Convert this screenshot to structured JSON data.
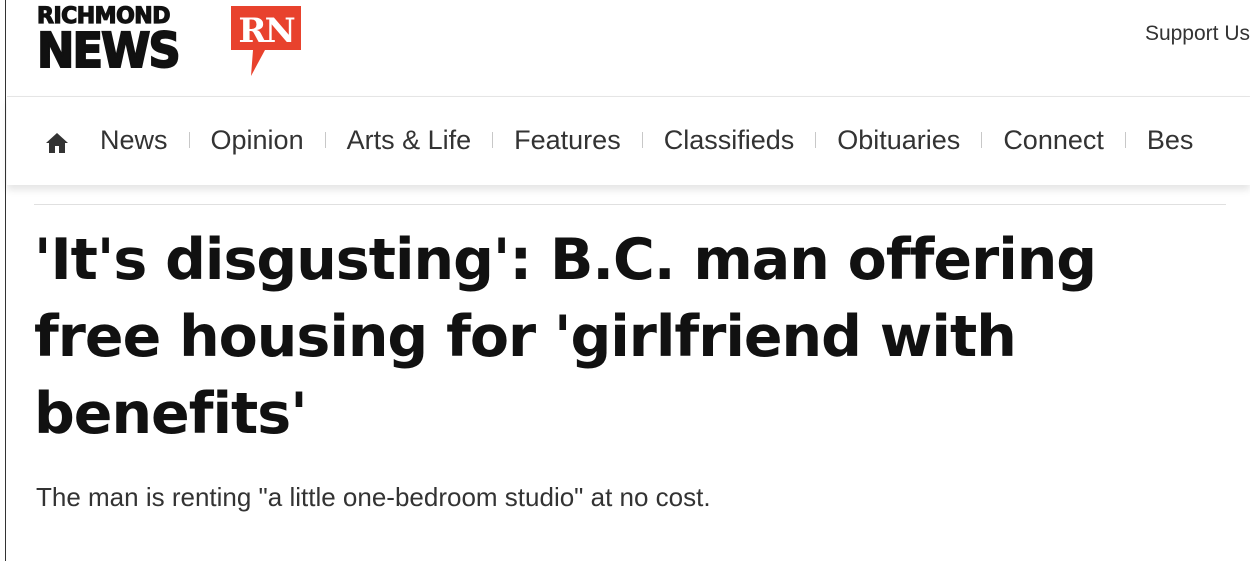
{
  "header": {
    "logo": {
      "line1": "RICHMOND",
      "line2": "NEWS",
      "badge": "RN"
    },
    "support_label": "Support Us"
  },
  "nav": {
    "items": [
      {
        "label": "News"
      },
      {
        "label": "Opinion"
      },
      {
        "label": "Arts & Life"
      },
      {
        "label": "Features"
      },
      {
        "label": "Classifieds"
      },
      {
        "label": "Obituaries"
      },
      {
        "label": "Connect"
      },
      {
        "label": "Bes"
      }
    ]
  },
  "article": {
    "headline": "'It's disgusting': B.C. man offering free housing for 'girlfriend with benefits'",
    "subhead": "The man is renting \"a little one-bedroom studio\" at no cost."
  },
  "colors": {
    "brand_red": "#e8422d",
    "text": "#111111",
    "nav_text": "#333333"
  },
  "icons": {
    "home": "home-icon"
  }
}
